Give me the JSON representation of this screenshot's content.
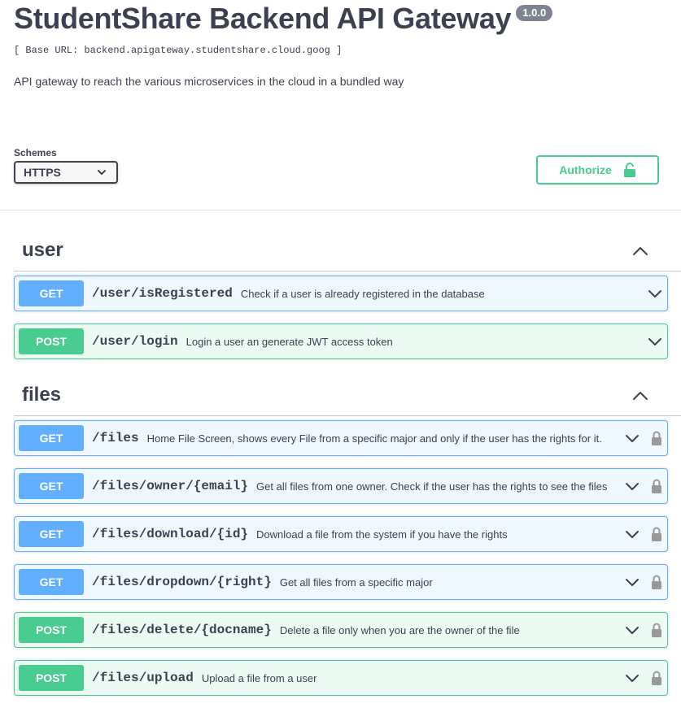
{
  "info": {
    "title": "StudentShare Backend API Gateway",
    "version": "1.0.0",
    "base_url": "[ Base URL: backend.apigateway.studentshare.cloud.goog ]",
    "description": "API gateway to reach the various microservices in the cloud in a bundled way"
  },
  "schemes": {
    "label": "Schemes",
    "selected": "HTTPS"
  },
  "authorize": {
    "label": "Authorize"
  },
  "tags": [
    {
      "name": "user",
      "operations": [
        {
          "method": "GET",
          "path": "/user/isRegistered",
          "summary": "Check if a user is already registered in the database",
          "locked": false
        },
        {
          "method": "POST",
          "path": "/user/login",
          "summary": "Login a user an generate JWT access token",
          "locked": false
        }
      ]
    },
    {
      "name": "files",
      "operations": [
        {
          "method": "GET",
          "path": "/files",
          "summary": "Home File Screen, shows every File from a specific major and only if the user has the rights for it.",
          "locked": true
        },
        {
          "method": "GET",
          "path": "/files/owner/{email}",
          "summary": "Get all files from one owner. Check if the user has the rights to see the files",
          "locked": true
        },
        {
          "method": "GET",
          "path": "/files/download/{id}",
          "summary": "Download a file from the system if you have the rights",
          "locked": true
        },
        {
          "method": "GET",
          "path": "/files/dropdown/{right}",
          "summary": "Get all files from a specific major",
          "locked": true
        },
        {
          "method": "POST",
          "path": "/files/delete/{docname}",
          "summary": "Delete a file only when you are the owner of the file",
          "locked": true
        },
        {
          "method": "POST",
          "path": "/files/upload",
          "summary": "Upload a file from a user",
          "locked": true
        }
      ]
    }
  ],
  "colors": {
    "get": "#61affe",
    "post": "#49cc90",
    "text": "#3b4151"
  }
}
